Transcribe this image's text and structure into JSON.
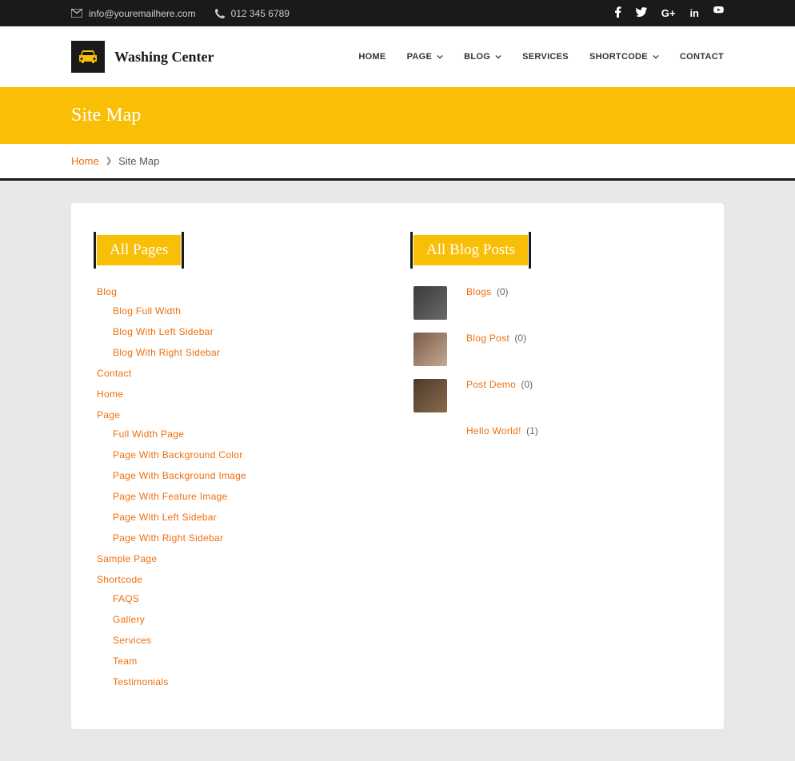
{
  "topbar": {
    "email": "info@youremailhere.com",
    "phone": "012 345 6789"
  },
  "brand": "Washing Center",
  "nav": {
    "home": "HOME",
    "page": "PAGE",
    "blog": "BLOG",
    "services": "SERVICES",
    "shortcode": "SHORTCODE",
    "contact": "CONTACT"
  },
  "hero": {
    "title": "Site Map"
  },
  "breadcrumb": {
    "home": "Home",
    "current": "Site Map"
  },
  "sections": {
    "pages": "All Pages",
    "posts": "All Blog Posts"
  },
  "tree": {
    "blog": "Blog",
    "blog_children": {
      "full": "Blog Full Width",
      "left": "Blog With Left Sidebar",
      "right": "Blog With Right Sidebar"
    },
    "contact": "Contact",
    "home": "Home",
    "page": "Page",
    "page_children": {
      "full": "Full Width Page",
      "bgc": "Page With Background Color",
      "bgi": "Page With Background Image",
      "feat": "Page With Feature Image",
      "left": "Page With Left Sidebar",
      "right": "Page With Right Sidebar"
    },
    "sample": "Sample Page",
    "shortcode": "Shortcode",
    "shortcode_children": {
      "faqs": "FAQS",
      "gallery": "Gallery",
      "services": "Services",
      "team": "Team",
      "testimonials": "Testimonials"
    }
  },
  "posts": {
    "p0": {
      "title": "Blogs",
      "count": "(0)"
    },
    "p1": {
      "title": "Blog Post",
      "count": "(0)"
    },
    "p2": {
      "title": "Post Demo",
      "count": "(0)"
    },
    "p3": {
      "title": "Hello World!",
      "count": "(1)"
    }
  }
}
